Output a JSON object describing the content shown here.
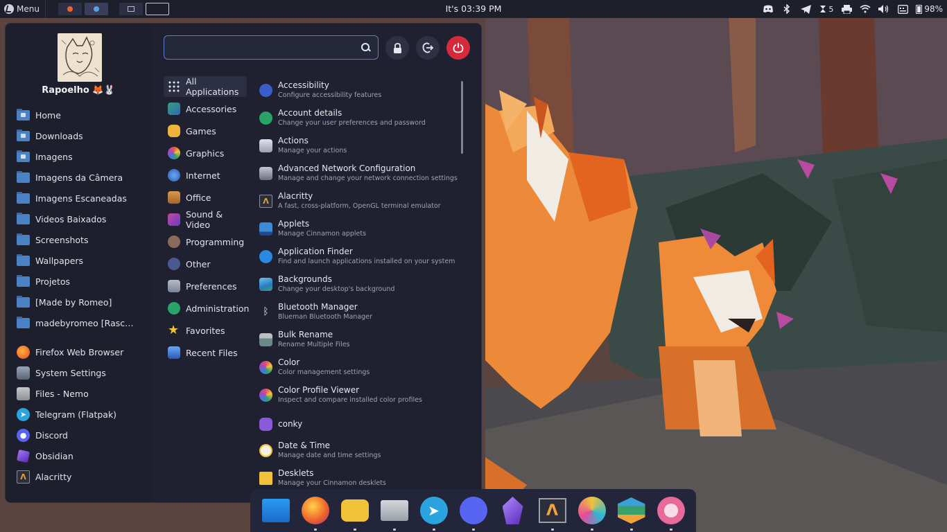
{
  "panel": {
    "menu_label": "Menu",
    "clock": "It's 03:39 PM",
    "notification_count": "5",
    "battery": "98%"
  },
  "menu": {
    "username": "Rapoelho 🦊🐰",
    "search_placeholder": "",
    "places": [
      {
        "label": "Home",
        "icon": "home-folder-icon"
      },
      {
        "label": "Downloads",
        "icon": "downloads-folder-icon"
      },
      {
        "label": "Imagens",
        "icon": "images-folder-icon"
      },
      {
        "label": "Imagens da Câmera",
        "icon": "folder-icon"
      },
      {
        "label": "Imagens Escaneadas",
        "icon": "folder-icon"
      },
      {
        "label": "Videos Baixados",
        "icon": "folder-icon"
      },
      {
        "label": "Screenshots",
        "icon": "folder-icon"
      },
      {
        "label": "Wallpapers",
        "icon": "folder-icon"
      },
      {
        "label": "Projetos",
        "icon": "folder-icon"
      },
      {
        "label": "[Made by Romeo]",
        "icon": "folder-icon"
      },
      {
        "label": "madebyromeo [Rascun…",
        "icon": "folder-icon"
      }
    ],
    "favorites": [
      {
        "label": "Firefox Web Browser",
        "icon": "firefox-icon",
        "color": "#e8662a"
      },
      {
        "label": "System Settings",
        "icon": "settings-icon",
        "color": "#6a7585"
      },
      {
        "label": "Files - Nemo",
        "icon": "files-icon",
        "color": "#9aa0a8"
      },
      {
        "label": "Telegram (Flatpak)",
        "icon": "telegram-icon",
        "color": "#2aa3de"
      },
      {
        "label": "Discord",
        "icon": "discord-icon",
        "color": "#5865f2"
      },
      {
        "label": "Obsidian",
        "icon": "obsidian-icon",
        "color": "#7c4fd8"
      },
      {
        "label": "Alacritty",
        "icon": "alacritty-icon",
        "color": "#e6a33a"
      }
    ],
    "categories": [
      {
        "label": "All Applications",
        "icon": "grid-icon",
        "color": "#2d3045",
        "selected": true
      },
      {
        "label": "Accessories",
        "icon": "accessories-icon",
        "color": "#3c9c7a"
      },
      {
        "label": "Games",
        "icon": "games-icon",
        "color": "#f0b43a"
      },
      {
        "label": "Graphics",
        "icon": "graphics-icon",
        "color": "#e2584a"
      },
      {
        "label": "Internet",
        "icon": "internet-icon",
        "color": "#3d7bd6"
      },
      {
        "label": "Office",
        "icon": "office-icon",
        "color": "#c7823a"
      },
      {
        "label": "Sound & Video",
        "icon": "sound-video-icon",
        "color": "#c24a9a"
      },
      {
        "label": "Programming",
        "icon": "programming-icon",
        "color": "#8a6a5a"
      },
      {
        "label": "Other",
        "icon": "other-icon",
        "color": "#4a5a90"
      },
      {
        "label": "Preferences",
        "icon": "preferences-icon",
        "color": "#8a92a8"
      },
      {
        "label": "Administration",
        "icon": "administration-icon",
        "color": "#2aa36a"
      },
      {
        "label": "Favorites",
        "icon": "star-icon",
        "color": "#f0c23a"
      },
      {
        "label": "Recent Files",
        "icon": "recent-files-icon",
        "color": "#3d7bd6"
      }
    ],
    "applications": [
      {
        "name": "Accessibility",
        "desc": "Configure accessibility features",
        "icon": "accessibility-icon",
        "color": "#3c5dc8"
      },
      {
        "name": "Account details",
        "desc": "Change your user preferences and password",
        "icon": "account-icon",
        "color": "#2aa36a"
      },
      {
        "name": "Actions",
        "desc": "Manage your actions",
        "icon": "actions-icon",
        "color": "#b8bcc8"
      },
      {
        "name": "Advanced Network Configuration",
        "desc": "Manage and change your network connection settings",
        "icon": "network-icon",
        "color": "#9aa0a8"
      },
      {
        "name": "Alacritty",
        "desc": "A fast, cross-platform, OpenGL terminal emulator",
        "icon": "alacritty-icon",
        "color": "#e6a33a"
      },
      {
        "name": "Applets",
        "desc": "Manage Cinnamon applets",
        "icon": "applets-icon",
        "color": "#3d8ad6"
      },
      {
        "name": "Application Finder",
        "desc": "Find and launch applications installed on your system",
        "icon": "app-finder-icon",
        "color": "#2a8ae0"
      },
      {
        "name": "Backgrounds",
        "desc": "Change your desktop's background",
        "icon": "backgrounds-icon",
        "color": "#3aa0d8"
      },
      {
        "name": "Bluetooth Manager",
        "desc": "Blueman Bluetooth Manager",
        "icon": "bluetooth-icon",
        "color": "#1f2130"
      },
      {
        "name": "Bulk Rename",
        "desc": "Rename Multiple Files",
        "icon": "bulk-rename-icon",
        "color": "#8a9aa0"
      },
      {
        "name": "Color",
        "desc": "Color management settings",
        "icon": "color-icon",
        "color": "#e84a6a"
      },
      {
        "name": "Color Profile Viewer",
        "desc": "Inspect and compare installed color profiles",
        "icon": "color-profile-icon",
        "color": "#e84a6a"
      },
      {
        "name": "conky",
        "desc": "",
        "icon": "conky-icon",
        "color": "#8a5ad8"
      },
      {
        "name": "Date & Time",
        "desc": "Manage date and time settings",
        "icon": "clock-icon",
        "color": "#f0c23a"
      },
      {
        "name": "Desklets",
        "desc": "Manage your Cinnamon desklets",
        "icon": "desklets-icon",
        "color": "#f0c23a"
      }
    ]
  },
  "dock": [
    {
      "name": "files-dock-icon",
      "color": "#2a8ae0",
      "running": false
    },
    {
      "name": "firefox-dock-icon",
      "color": "#e8662a",
      "running": true
    },
    {
      "name": "games-dock-icon",
      "color": "#f0c23a",
      "running": true
    },
    {
      "name": "nemo-dock-icon",
      "color": "#b8bcc8",
      "running": true
    },
    {
      "name": "telegram-dock-icon",
      "color": "#2aa3de",
      "running": true
    },
    {
      "name": "discord-dock-icon",
      "color": "#5865f2",
      "running": true
    },
    {
      "name": "obsidian-dock-icon",
      "color": "#7c4fd8",
      "running": false
    },
    {
      "name": "alacritty-dock-icon",
      "color": "#3a3e4a",
      "running": true
    },
    {
      "name": "krita-dock-icon",
      "color": "#2ab8d8",
      "running": true
    },
    {
      "name": "layers-dock-icon",
      "color": "#3aa0d8",
      "running": true
    },
    {
      "name": "cherry-dock-icon",
      "color": "#e86a9a",
      "running": true
    }
  ]
}
